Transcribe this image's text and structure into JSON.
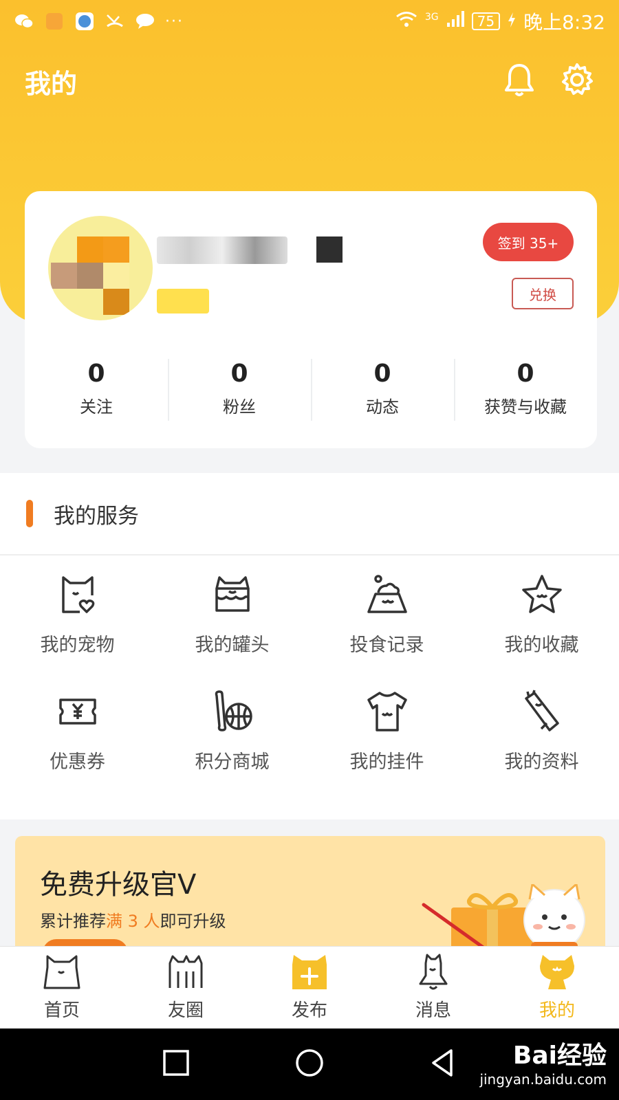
{
  "status_bar": {
    "time": "晚上8:32",
    "battery": "75",
    "network": "3G"
  },
  "header": {
    "title": "我的",
    "bell_icon": "bell-icon",
    "settings_icon": "gear-icon"
  },
  "profile": {
    "checkin_label": "签到 35+",
    "exchange_label": "兑换",
    "stats": [
      {
        "value": "0",
        "label": "关注"
      },
      {
        "value": "0",
        "label": "粉丝"
      },
      {
        "value": "0",
        "label": "动态"
      },
      {
        "value": "0",
        "label": "获赞与收藏"
      }
    ]
  },
  "services": {
    "title": "我的服务",
    "items": [
      {
        "label": "我的宠物",
        "icon": "cat-heart-icon"
      },
      {
        "label": "我的罐头",
        "icon": "can-icon"
      },
      {
        "label": "投食记录",
        "icon": "bowl-icon"
      },
      {
        "label": "我的收藏",
        "icon": "star-icon"
      },
      {
        "label": "优惠券",
        "icon": "coupon-icon"
      },
      {
        "label": "积分商城",
        "icon": "points-mall-icon"
      },
      {
        "label": "我的挂件",
        "icon": "shirt-icon"
      },
      {
        "label": "我的资料",
        "icon": "profile-tag-icon"
      }
    ]
  },
  "promo": {
    "title": "免费升级官V",
    "sub_prefix": "累计推荐",
    "sub_highlight": "满 3 人",
    "sub_suffix": "即可升级"
  },
  "bottom_nav": {
    "items": [
      {
        "label": "首页",
        "icon": "home-cat-icon"
      },
      {
        "label": "友圈",
        "icon": "friends-icon"
      },
      {
        "label": "发布",
        "icon": "publish-icon"
      },
      {
        "label": "消息",
        "icon": "message-bell-icon"
      },
      {
        "label": "我的",
        "icon": "me-cat-icon"
      }
    ],
    "active": "我的"
  },
  "watermark": {
    "brand": "Bai经验",
    "url": "jingyan.baidu.com"
  },
  "colors": {
    "header_yellow": "#fbc02d",
    "checkin_red": "#e84841",
    "accent_orange": "#f07c21",
    "active_nav": "#f3b81b"
  }
}
